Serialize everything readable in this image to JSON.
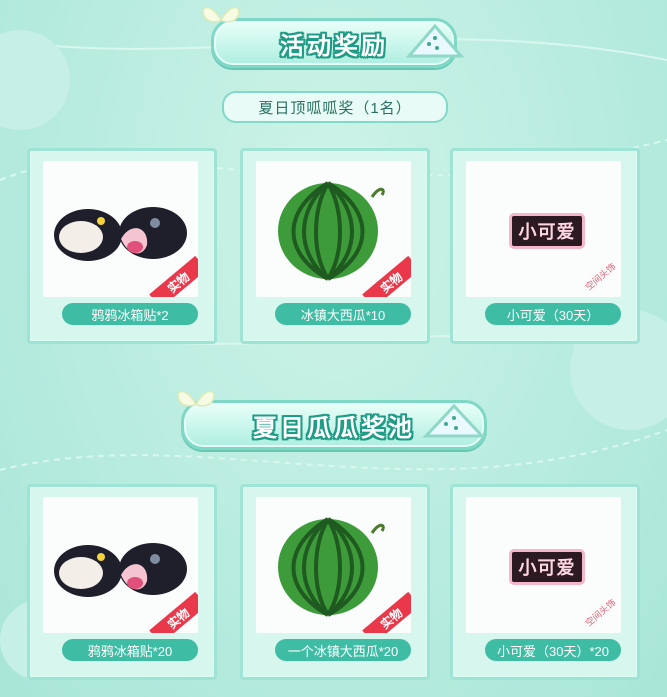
{
  "section1": {
    "title": "活动奖励",
    "subtitle": "夏日顶呱呱奖（1名）"
  },
  "section2": {
    "title": "夏日瓜瓜奖池"
  },
  "tag_label": "实物",
  "avatar_tag_label": "空间头饰",
  "nameplate_text": "小可爱",
  "row1": [
    {
      "caption": "鸦鸦冰箱贴*2"
    },
    {
      "caption": "冰镇大西瓜*10"
    },
    {
      "caption": "小可爱（30天）"
    }
  ],
  "row2": [
    {
      "caption": "鸦鸦冰箱贴*20"
    },
    {
      "caption": "一个冰镇大西瓜*20"
    },
    {
      "caption": "小可爱（30天）*20"
    }
  ],
  "colors": {
    "accent": "#3fbca4",
    "background": "#b8ecdf",
    "tag": "#e8384a"
  }
}
